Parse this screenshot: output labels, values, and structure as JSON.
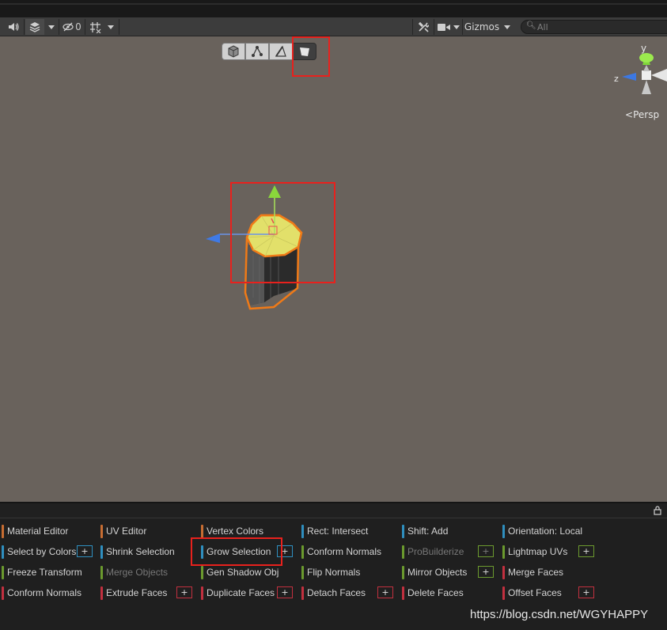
{
  "scene_toolbar": {
    "hidden_count": "0",
    "gizmos_label": "Gizmos",
    "search_placeholder": "All"
  },
  "viewport": {
    "axis_y_label": "y",
    "axis_z_label": "z",
    "projection_label": "Persp"
  },
  "probuilder": {
    "buttons": [
      {
        "label": "Material Editor",
        "color": "#c76d32",
        "enabled": true
      },
      {
        "label": "UV Editor",
        "color": "#c76d32",
        "enabled": true
      },
      {
        "label": "Vertex Colors",
        "color": "#c76d32",
        "enabled": true
      },
      {
        "label": "Rect: Intersect",
        "color": "#2f8fbf",
        "enabled": true
      },
      {
        "label": "Shift: Add",
        "color": "#2f8fbf",
        "enabled": true
      },
      {
        "label": "Orientation: Local",
        "color": "#2f8fbf",
        "enabled": true
      },
      {
        "label": "Select by Colors",
        "color": "#2f8fbf",
        "enabled": true,
        "has_options": true
      },
      {
        "label": "Shrink Selection",
        "color": "#2f8fbf",
        "enabled": true
      },
      {
        "label": "Grow Selection",
        "color": "#2f8fbf",
        "enabled": true,
        "has_options": true
      },
      {
        "label": "Conform Normals",
        "color": "#6b9a2e",
        "enabled": true
      },
      {
        "label": "ProBuilderize",
        "color": "#6b9a2e",
        "enabled": false,
        "has_options": true
      },
      {
        "label": "Lightmap UVs",
        "color": "#6b9a2e",
        "enabled": true,
        "has_options": true
      },
      {
        "label": "Freeze Transform",
        "color": "#6b9a2e",
        "enabled": true
      },
      {
        "label": "Merge Objects",
        "color": "#6b9a2e",
        "enabled": false
      },
      {
        "label": "Gen Shadow Obj",
        "color": "#6b9a2e",
        "enabled": true
      },
      {
        "label": "Flip Normals",
        "color": "#6b9a2e",
        "enabled": true
      },
      {
        "label": "Mirror Objects",
        "color": "#6b9a2e",
        "enabled": true,
        "has_options": true
      },
      {
        "label": "Merge Faces",
        "color": "#c2303f",
        "enabled": true
      },
      {
        "label": "Conform Normals",
        "color": "#c2303f",
        "enabled": true
      },
      {
        "label": "Extrude Faces",
        "color": "#c2303f",
        "enabled": true,
        "has_options": true
      },
      {
        "label": "Duplicate Faces",
        "color": "#c2303f",
        "enabled": true,
        "has_options": true
      },
      {
        "label": "Detach Faces",
        "color": "#c2303f",
        "enabled": true,
        "has_options": true
      },
      {
        "label": "Delete Faces",
        "color": "#c2303f",
        "enabled": true
      },
      {
        "label": "Offset Faces",
        "color": "#c2303f",
        "enabled": true,
        "has_options": true
      }
    ],
    "plus_label": "+"
  },
  "watermark": "https://blog.csdn.net/WGYHAPPY",
  "colors": {
    "viewport_bg": "#69625c",
    "highlight_red": "#e8211d",
    "selection_orange": "#f07a17",
    "selected_face_yellow": "#e8e66a"
  }
}
